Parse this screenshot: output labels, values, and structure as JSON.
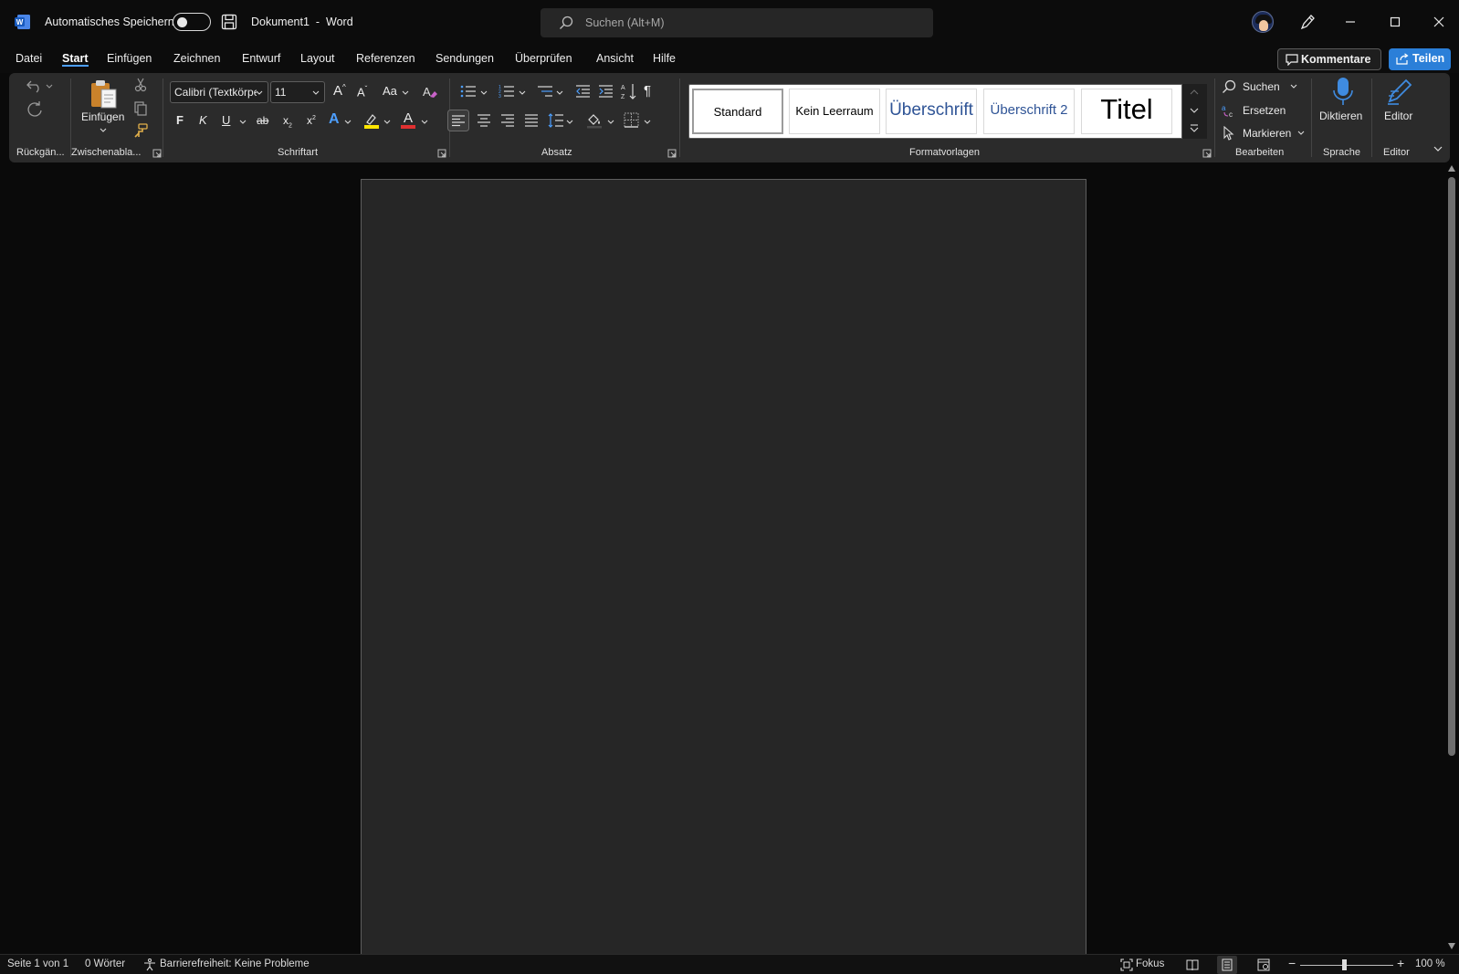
{
  "titlebar": {
    "autosave_label": "Automatisches Speichern",
    "autosave_on": false,
    "doc_name": "Dokument1",
    "separator": "-",
    "app_name": "Word",
    "search_placeholder": "Suchen (Alt+M)"
  },
  "menu": {
    "tabs": [
      "Datei",
      "Start",
      "Einfügen",
      "Zeichnen",
      "Entwurf",
      "Layout",
      "Referenzen",
      "Sendungen",
      "Überprüfen",
      "Ansicht",
      "Hilfe"
    ],
    "active_tab": "Start",
    "comments_label": "Kommentare",
    "share_label": "Teilen"
  },
  "ribbon": {
    "undo_group_label": "Rückgän...",
    "clipboard_group_label": "Zwischenabla...",
    "paste_label": "Einfügen",
    "font_group_label": "Schriftart",
    "font_name": "Calibri (Textkörper)",
    "font_size": "11",
    "grow_font": "A",
    "shrink_font": "A",
    "change_case": "Aa",
    "bold": "F",
    "italic": "K",
    "underline": "U",
    "strike": "ab",
    "subscript": "x",
    "superscript": "x",
    "text_effects": "A",
    "font_color": "A",
    "paragraph_group_label": "Absatz",
    "styles_group_label": "Formatvorlagen",
    "styles": [
      "Standard",
      "Kein Leerraum",
      "Überschrift",
      "Überschrift 2",
      "Titel"
    ],
    "edit_group_label": "Bearbeiten",
    "find_label": "Suchen",
    "replace_label": "Ersetzen",
    "select_label": "Markieren",
    "voice_group_label": "Sprache",
    "dictate_label": "Diktieren",
    "editor_group_label": "Editor",
    "editor_label": "Editor"
  },
  "statusbar": {
    "page": "Seite 1 von 1",
    "words": "0 Wörter",
    "accessibility": "Barrierefreiheit: Keine Probleme",
    "focus": "Fokus",
    "zoom": "100 %"
  },
  "colors": {
    "accent": "#2b7fd8",
    "tab_underline": "#4d9fff",
    "heading_blue": "#2f5496",
    "highlight_yellow": "#ffe600",
    "font_red": "#e03030"
  }
}
